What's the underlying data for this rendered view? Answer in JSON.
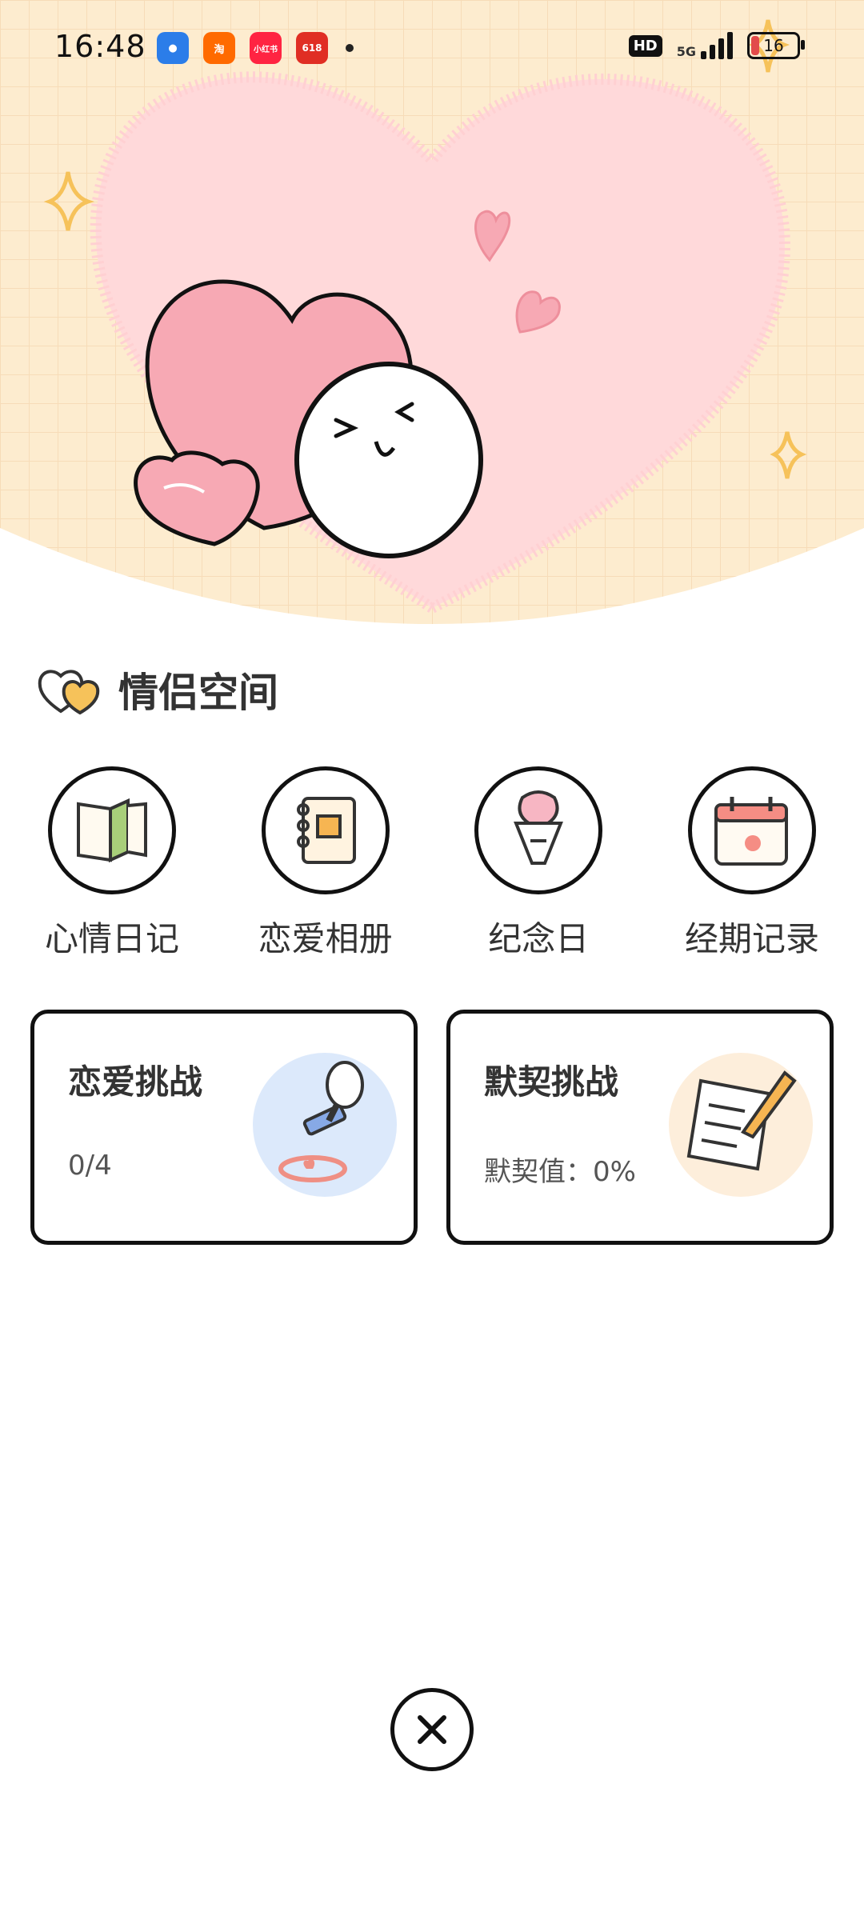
{
  "status_bar": {
    "time": "16:48",
    "apps": [
      {
        "name": "map-app-icon",
        "label": "",
        "color": "#2b7de9"
      },
      {
        "name": "taobao-app-icon",
        "label": "淘",
        "color": "#ff6a00"
      },
      {
        "name": "xiaohongshu-app-icon",
        "label": "小红书",
        "color": "#ff2442"
      },
      {
        "name": "pinduoduo-app-icon",
        "label": "618",
        "color": "#e02e24"
      }
    ],
    "hd": "HD",
    "network": "5G",
    "battery": "16"
  },
  "section": {
    "title": "情侣空间"
  },
  "features": [
    {
      "label": "心情日记",
      "icon": "book-icon"
    },
    {
      "label": "恋爱相册",
      "icon": "album-icon"
    },
    {
      "label": "纪念日",
      "icon": "bouquet-icon"
    },
    {
      "label": "经期记录",
      "icon": "calendar-icon"
    }
  ],
  "cards": [
    {
      "title": "恋爱挑战",
      "subtitle": "0/4",
      "icon": "stamp-icon"
    },
    {
      "title": "默契挑战",
      "subtitle": "默契值：0%",
      "icon": "note-pencil-icon"
    }
  ],
  "colors": {
    "hero_bg": "#fdeccf",
    "heart_pink": "#ffd9da",
    "accent_pink": "#f7a9b4",
    "sparkle": "#f6c25a"
  }
}
